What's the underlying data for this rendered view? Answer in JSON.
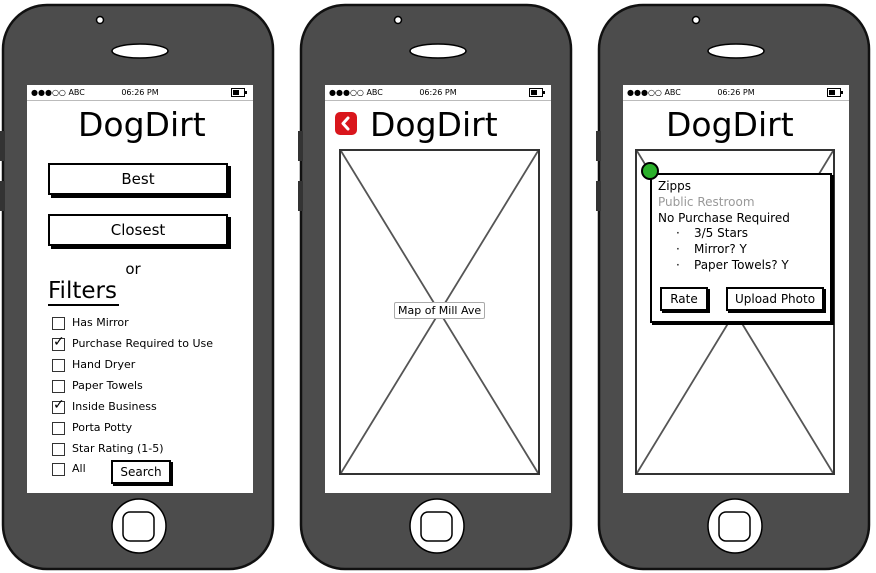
{
  "status_bar": {
    "carrier": "●●●○○ ABC",
    "time": "06:26 PM"
  },
  "app": {
    "logo": "DogDirt"
  },
  "screen1": {
    "best_label": "Best",
    "closest_label": "Closest",
    "or_label": "or",
    "filters_heading": "Filters",
    "filters": [
      {
        "label": "Has Mirror",
        "checked": false
      },
      {
        "label": "Purchase Required to Use",
        "checked": true
      },
      {
        "label": "Hand Dryer",
        "checked": false
      },
      {
        "label": "Paper Towels",
        "checked": false
      },
      {
        "label": "Inside Business",
        "checked": true
      },
      {
        "label": "Porta Potty",
        "checked": false
      },
      {
        "label": "Star Rating (1-5)",
        "checked": false
      },
      {
        "label": "All",
        "checked": false
      }
    ],
    "search_label": "Search"
  },
  "screen2": {
    "back_icon": "chevron-left-icon",
    "map_label": "Map of Mill Ave"
  },
  "screen3": {
    "place_name": "Zipps",
    "place_type": "Public Restroom",
    "purchase_note": "No Purchase Required",
    "details": [
      "3/5 Stars",
      "Mirror? Y",
      "Paper Towels? Y"
    ],
    "rate_label": "Rate",
    "upload_label": "Upload Photo"
  },
  "colors": {
    "accent": "#d9161c",
    "pin": "#2bb02b",
    "phone": "#4c4c4c"
  }
}
